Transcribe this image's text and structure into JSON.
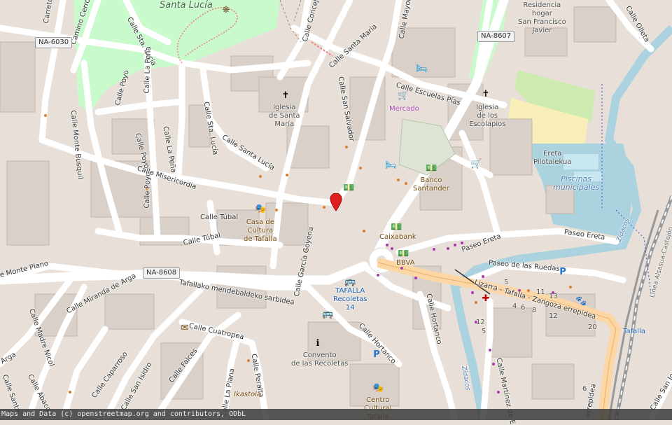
{
  "map": {
    "attribution": "Maps and Data (c) openstreetmap.org and contributors, ODbL",
    "colors": {
      "road": "#ffffff",
      "primary": "#fcd6a4",
      "park": "#c8facc",
      "water": "#aad3df",
      "building": "#d9d0c9",
      "land": "#e8e0d8"
    }
  },
  "streets": {
    "santa_lucia_park": "Santa Lucía",
    "carretera": "Carrete",
    "camino_cerro": "Camino Cerro",
    "calle_sta_lucia_top": "Calle Sta. Lucía",
    "calle_la_pena_1": "Calle La Peña",
    "calle_la_pena_2": "Calle La Peña",
    "calle_poyo_1": "Calle Poyo",
    "calle_poyo_2": "Calle Poyo",
    "calle_poyo_3": "Calle Poyo",
    "calle_monte_busquil": "Calle Monte Busquil",
    "calle_sta_lucia_mid": "Calle Sta. Lucía",
    "calle_santa_lucia": "Calle Santa Lucía",
    "calle_misericordia": "Calle Misericordia",
    "calle_tubal_1": "Calle Túbal",
    "calle_tubal_2": "Calle Túbal",
    "calle_concejo": "Calle Concej",
    "calle_santa_maria": "Calle Santa María",
    "calle_mayor": "Calle Mayor",
    "calle_san_salvador": "Calle San Salvador",
    "calle_escuelas_pias": "Calle Escuelas Pías",
    "calle_olleta": "Calle Olleta",
    "paseo_ereta_1": "Paseo Ereta",
    "paseo_ereta_2": "Paseo Ereta",
    "paseo_ruedas": "Paseo de las Ruedas",
    "lizarra": "Lizarra - Tafalla - Zangoza errepidea",
    "errepidea2": "errepidea",
    "calle_garcia_goyena": "Calle García Goyena",
    "calle_hortanco_1": "Calle Hortanco",
    "calle_hortanco_2": "Calle Hortanco",
    "calle_martinez": "Calle Martínez de E",
    "calle_monte_plano": "e Monte Plano",
    "calle_miranda": "Calle Miranda de Arga",
    "tafallako": "Tafallako mendebaldeko sarbidea",
    "calle_madre_nicol": "Calle Madre Nicol",
    "calle_cuatropea": "Calle Cuatropea",
    "calle_caparroso": "Calle Caparroso",
    "calle_san_isidro": "Calle San Isidro",
    "calle_falces": "Calle Falces",
    "calle_la_plana": "Calle La Plana",
    "calle_peralta": "Calle Peralta",
    "calle_abaco": "Calle Abaco",
    "calle_santa": "Calle Santa",
    "arga": "Arga",
    "calle_san_jose": "Calle San José",
    "zidacos_1": "Zidacos",
    "zidacos_2": "Zidacos",
    "zidacos_3": "Zidacos",
    "linea": "Línea Alsasua-Castejón"
  },
  "shields": {
    "na6030": "NA-6030",
    "na8607": "NA-8607",
    "na8608": "NA-8608"
  },
  "pois": {
    "iglesia_santa_maria": "Iglesia\nde Santa\nMaría",
    "mercado": "Mercado",
    "iglesia_escolapios": "Iglesia\nde los\nEscolapios",
    "residencia": "Residencia\nhogar\nSan Francisco\nJavier",
    "ereta": "Ereta\nPilotalekua",
    "piscinas": "Piscinas\nmunicipales",
    "banco_santander": "Banco\nSantander",
    "caixabank": "Caixabank",
    "bbva": "BBVA",
    "casa_cultura": "Casa de\nCultura\nde Tafalla",
    "tafalla_recoletas": "TAFALLA\nRecoletas\n14",
    "convento": "Convento\nde las Recoletas",
    "ikastola": "Ikastola",
    "centro_cultural": "Centro\nCultural\nTafalla",
    "tafalla_station": "Tafalla"
  },
  "house_numbers": [
    "5",
    "11",
    "13",
    "4",
    "6",
    "8",
    "12",
    "20",
    "12",
    "6",
    "5"
  ],
  "icons": {
    "church": "✝",
    "bed": "🛏",
    "bank": "💵",
    "info": "ℹ",
    "parking": "P",
    "bus": "🚌",
    "post": "✉",
    "theatre": "🎭",
    "cart": "🛒",
    "hospital": "✚",
    "paw": "🐾",
    "viewpoint": "❋"
  }
}
